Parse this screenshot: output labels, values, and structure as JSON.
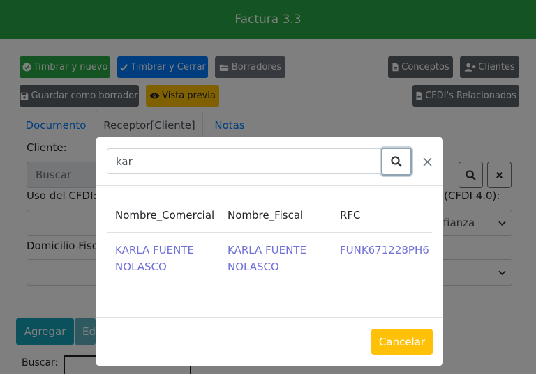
{
  "header": {
    "title": "Factura 3.3"
  },
  "toolbar": {
    "timbrar_nuevo": "Timbrar y nuevo",
    "timbrar_cerrar": "Timbrar y Cerrar",
    "borradores": "Borradores",
    "conceptos": "Conceptos",
    "clientes": "Clientes",
    "guardar_borrador": "Guardar como borrador",
    "vista_previa": "Vista previa",
    "cfdi_relacionados": "CFDI's Relacionados"
  },
  "tabs": [
    {
      "label": "Documento"
    },
    {
      "label": "Receptor[Cliente]"
    },
    {
      "label": "Notas"
    }
  ],
  "form": {
    "cliente_label": "Cliente:",
    "buscar_placeholder": "Buscar",
    "uso_cfdi_label": "Uso del CFDI:",
    "cfdi40_label": "(CFDI 4.0):",
    "select_value": "fianza",
    "domicilio_label": "Domicilio Fisca",
    "agregar": "Agregar",
    "editar_partial": "Ed",
    "buscar_label": "Buscar:"
  },
  "modal": {
    "search_value": "kar",
    "columns": [
      "Nombre_Comercial",
      "Nombre_Fiscal",
      "RFC"
    ],
    "rows": [
      {
        "comercial": [
          "KARLA FUENTE",
          "NOLASCO"
        ],
        "fiscal": [
          "KARLA FUENTE",
          "NOLASCO"
        ],
        "rfc": "FUNK671228PH6"
      }
    ],
    "cancel_label": "Cancelar"
  },
  "colors": {
    "header": "#28a745",
    "primary": "#007bff",
    "secondary": "#6c757d",
    "warning": "#ffc107",
    "info": "#17a2b8",
    "link": "#6f6fd8"
  }
}
